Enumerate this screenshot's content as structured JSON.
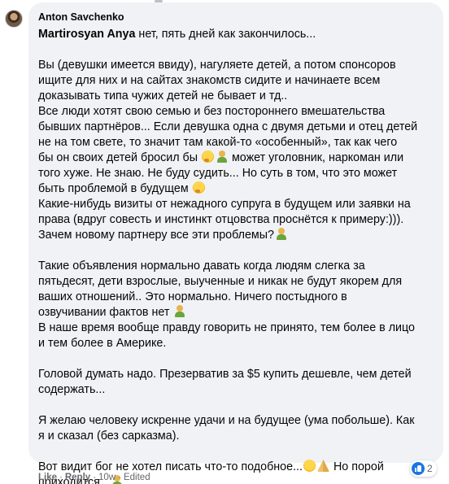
{
  "comment": {
    "author": "Anton Savchenko",
    "mention": "Martirosyan Anya",
    "first_line_rest": " нет, пять дней как закончилось...",
    "paragraphs": [
      [
        "Вы (девушки имеется ввиду), нагуляете детей, а потом спонсоров",
        "ищите для них и на сайтах знакомств сидите и начинаете всем",
        "доказывать типа чужих детей не бывает и тд..",
        "Все люди хотят свою семью и без постороннего вмешательства",
        "бывших партнёров... Если девушка одна с двумя детьми и отец детей",
        "не на том свете, то значит там какой-то «особенный», так как чего",
        "бы он своих детей бросил бы {thinking}{person} может уголовник, наркоман или",
        "того хуже. Не знаю. Не буду судить... Но суть в том, что это может",
        "быть проблемой в будущем {thinking}",
        "Какие-нибудь визиты от нежадного супруга в будущем или заявки на",
        "права (вдруг совесть и инстинкт отцовства проснётся к примеру:))).",
        "Зачем новому партнеру все эти проблемы?{person}"
      ],
      [
        "Такие объявления нормально давать когда людям слегка за",
        "пятьдесят, дети взрослые, выученные и никак не будут якорем для",
        "ваших отношений.. Это нормально. Ничего постыдного в",
        "озвучивании фактов нет {person}",
        "В наше время вообще правду говорить не принято, тем более в лицо",
        "и тем более в Америке."
      ],
      [
        "Головой думать надо. Презерватив за $5 купить дешевле, чем детей",
        "содержать..."
      ],
      [
        "Я желаю человеку искренне удачи и на будущее (ума побольше). Как",
        "я и сказал (без сарказма)."
      ],
      [
        "Вот видит бог не хотел писать что-то подобное...{wink}{pray} Но порой",
        "приходится...{person}"
      ]
    ],
    "emoji_names": {
      "thinking": "thinking-face-emoji",
      "person": "person-gesturing-emoji",
      "wink": "winking-face-emoji",
      "pray": "folded-hands-emoji"
    }
  },
  "actions": {
    "like": "Like",
    "reply": "Reply",
    "separator": "·",
    "time": "10w",
    "edited": "Edited"
  },
  "reactions": {
    "count": "2",
    "type": "like"
  },
  "colors": {
    "bubble": "#f0f2f5",
    "meta_text": "#65676b",
    "like_blue": "#1b74e4"
  }
}
